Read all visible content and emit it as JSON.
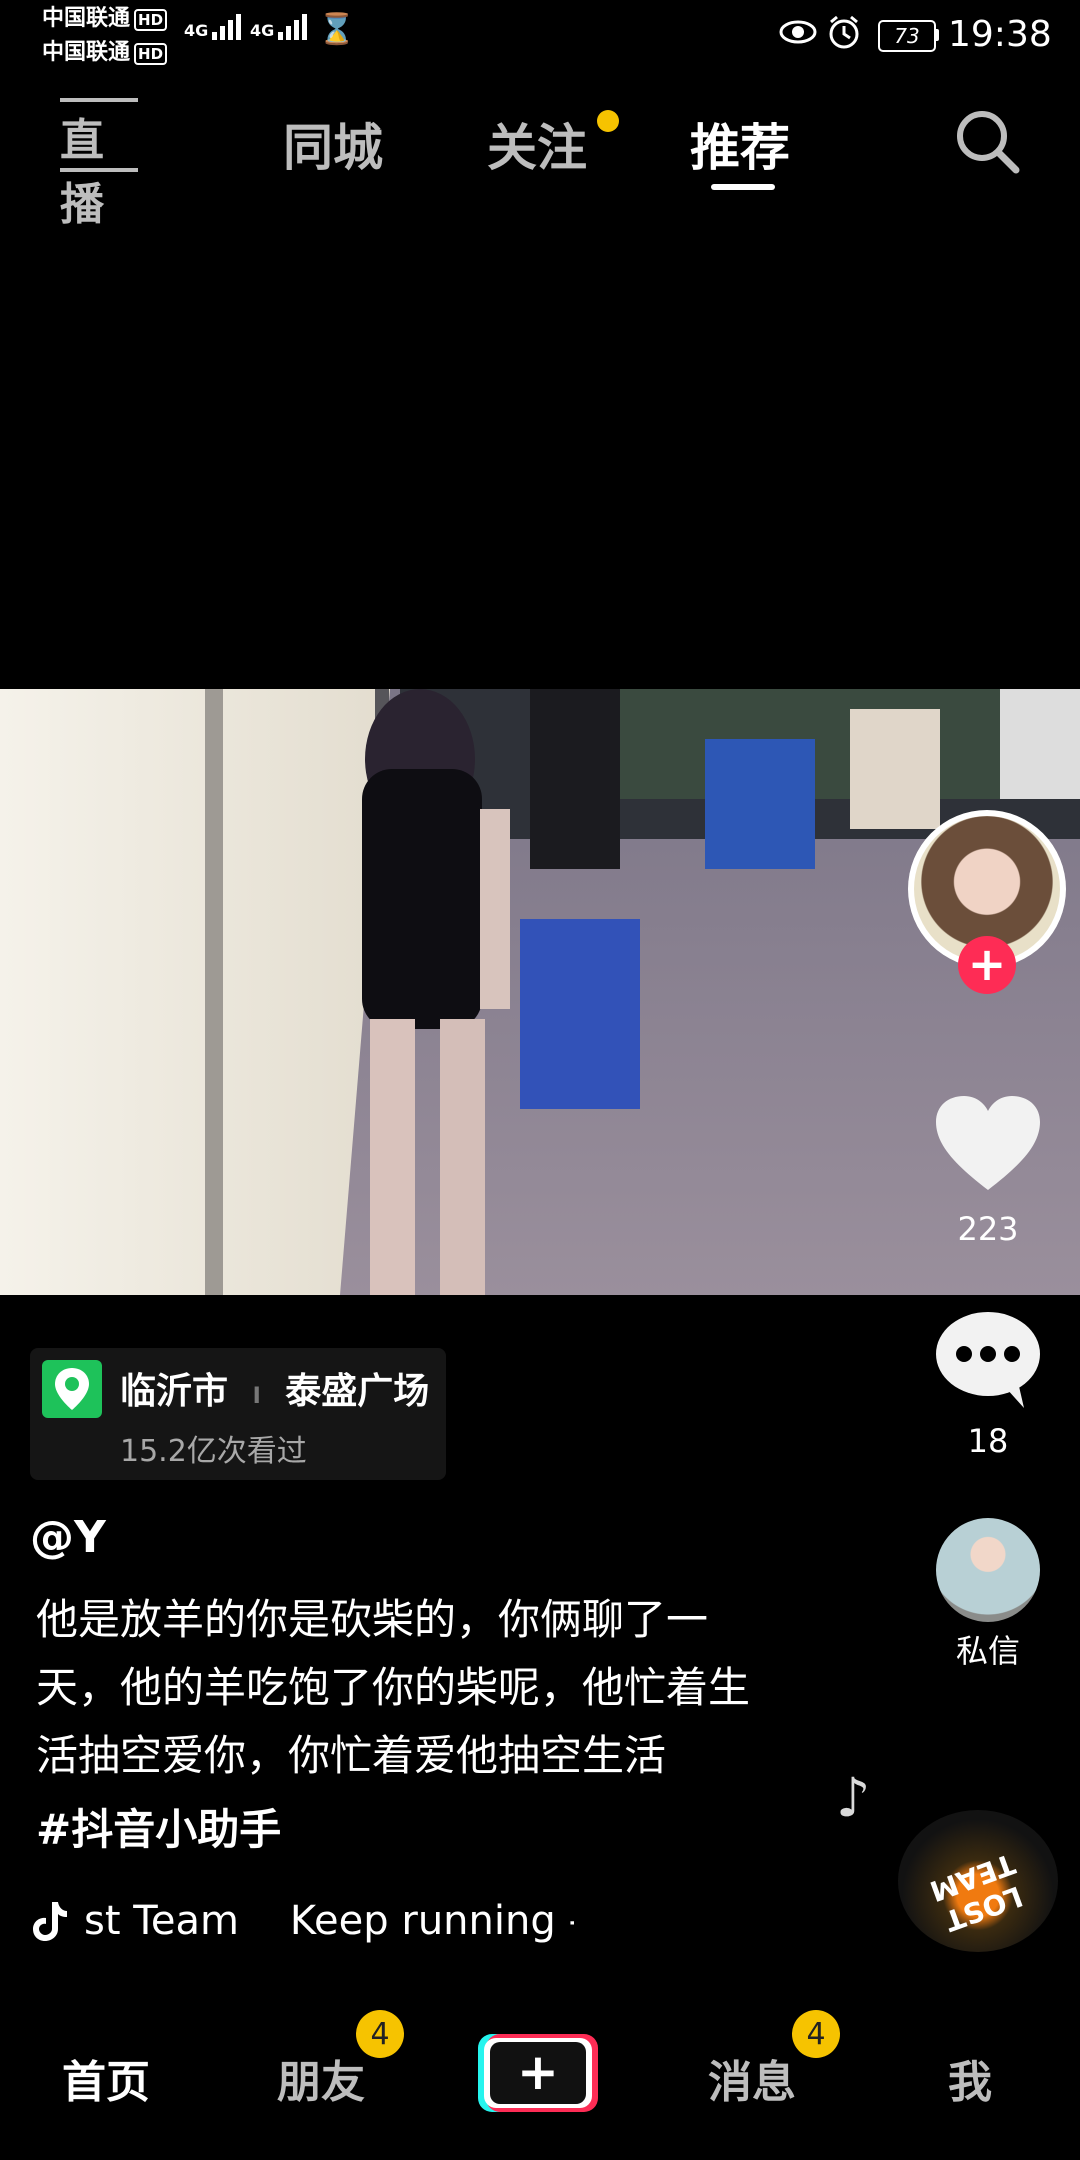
{
  "status_bar": {
    "carrier1": "中国联通",
    "carrier2": "中国联通",
    "hd": "HD",
    "net1": "4G",
    "net2": "4G",
    "battery": "73",
    "time": "19:38"
  },
  "top_nav": {
    "live_label": "直播",
    "tabs": [
      "同城",
      "关注",
      "推荐"
    ],
    "active_tab": "推荐"
  },
  "side": {
    "likes": "223",
    "comments": "18",
    "dm_label": "私信"
  },
  "location": {
    "city": "临沂市",
    "separator": "I",
    "place": "泰盛广场",
    "views": "15.2亿次看过"
  },
  "post": {
    "author": "@Y",
    "caption": "他是放羊的你是砍柴的，你俩聊了一天，他的羊吃饱了你的柴呢，他忙着生活抽空爱你，你忙着爱他抽空生活",
    "hashtag": "#抖音小助手",
    "music": "st Team    Keep running - L",
    "album_text": "LOST TEAM"
  },
  "bottom_nav": {
    "home": "首页",
    "friends": "朋友",
    "friends_badge": "4",
    "messages": "消息",
    "messages_badge": "4",
    "me": "我"
  },
  "colors": {
    "accent_red": "#fe2c55",
    "badge_yellow": "#f6c300",
    "location_green": "#1ec25a"
  }
}
